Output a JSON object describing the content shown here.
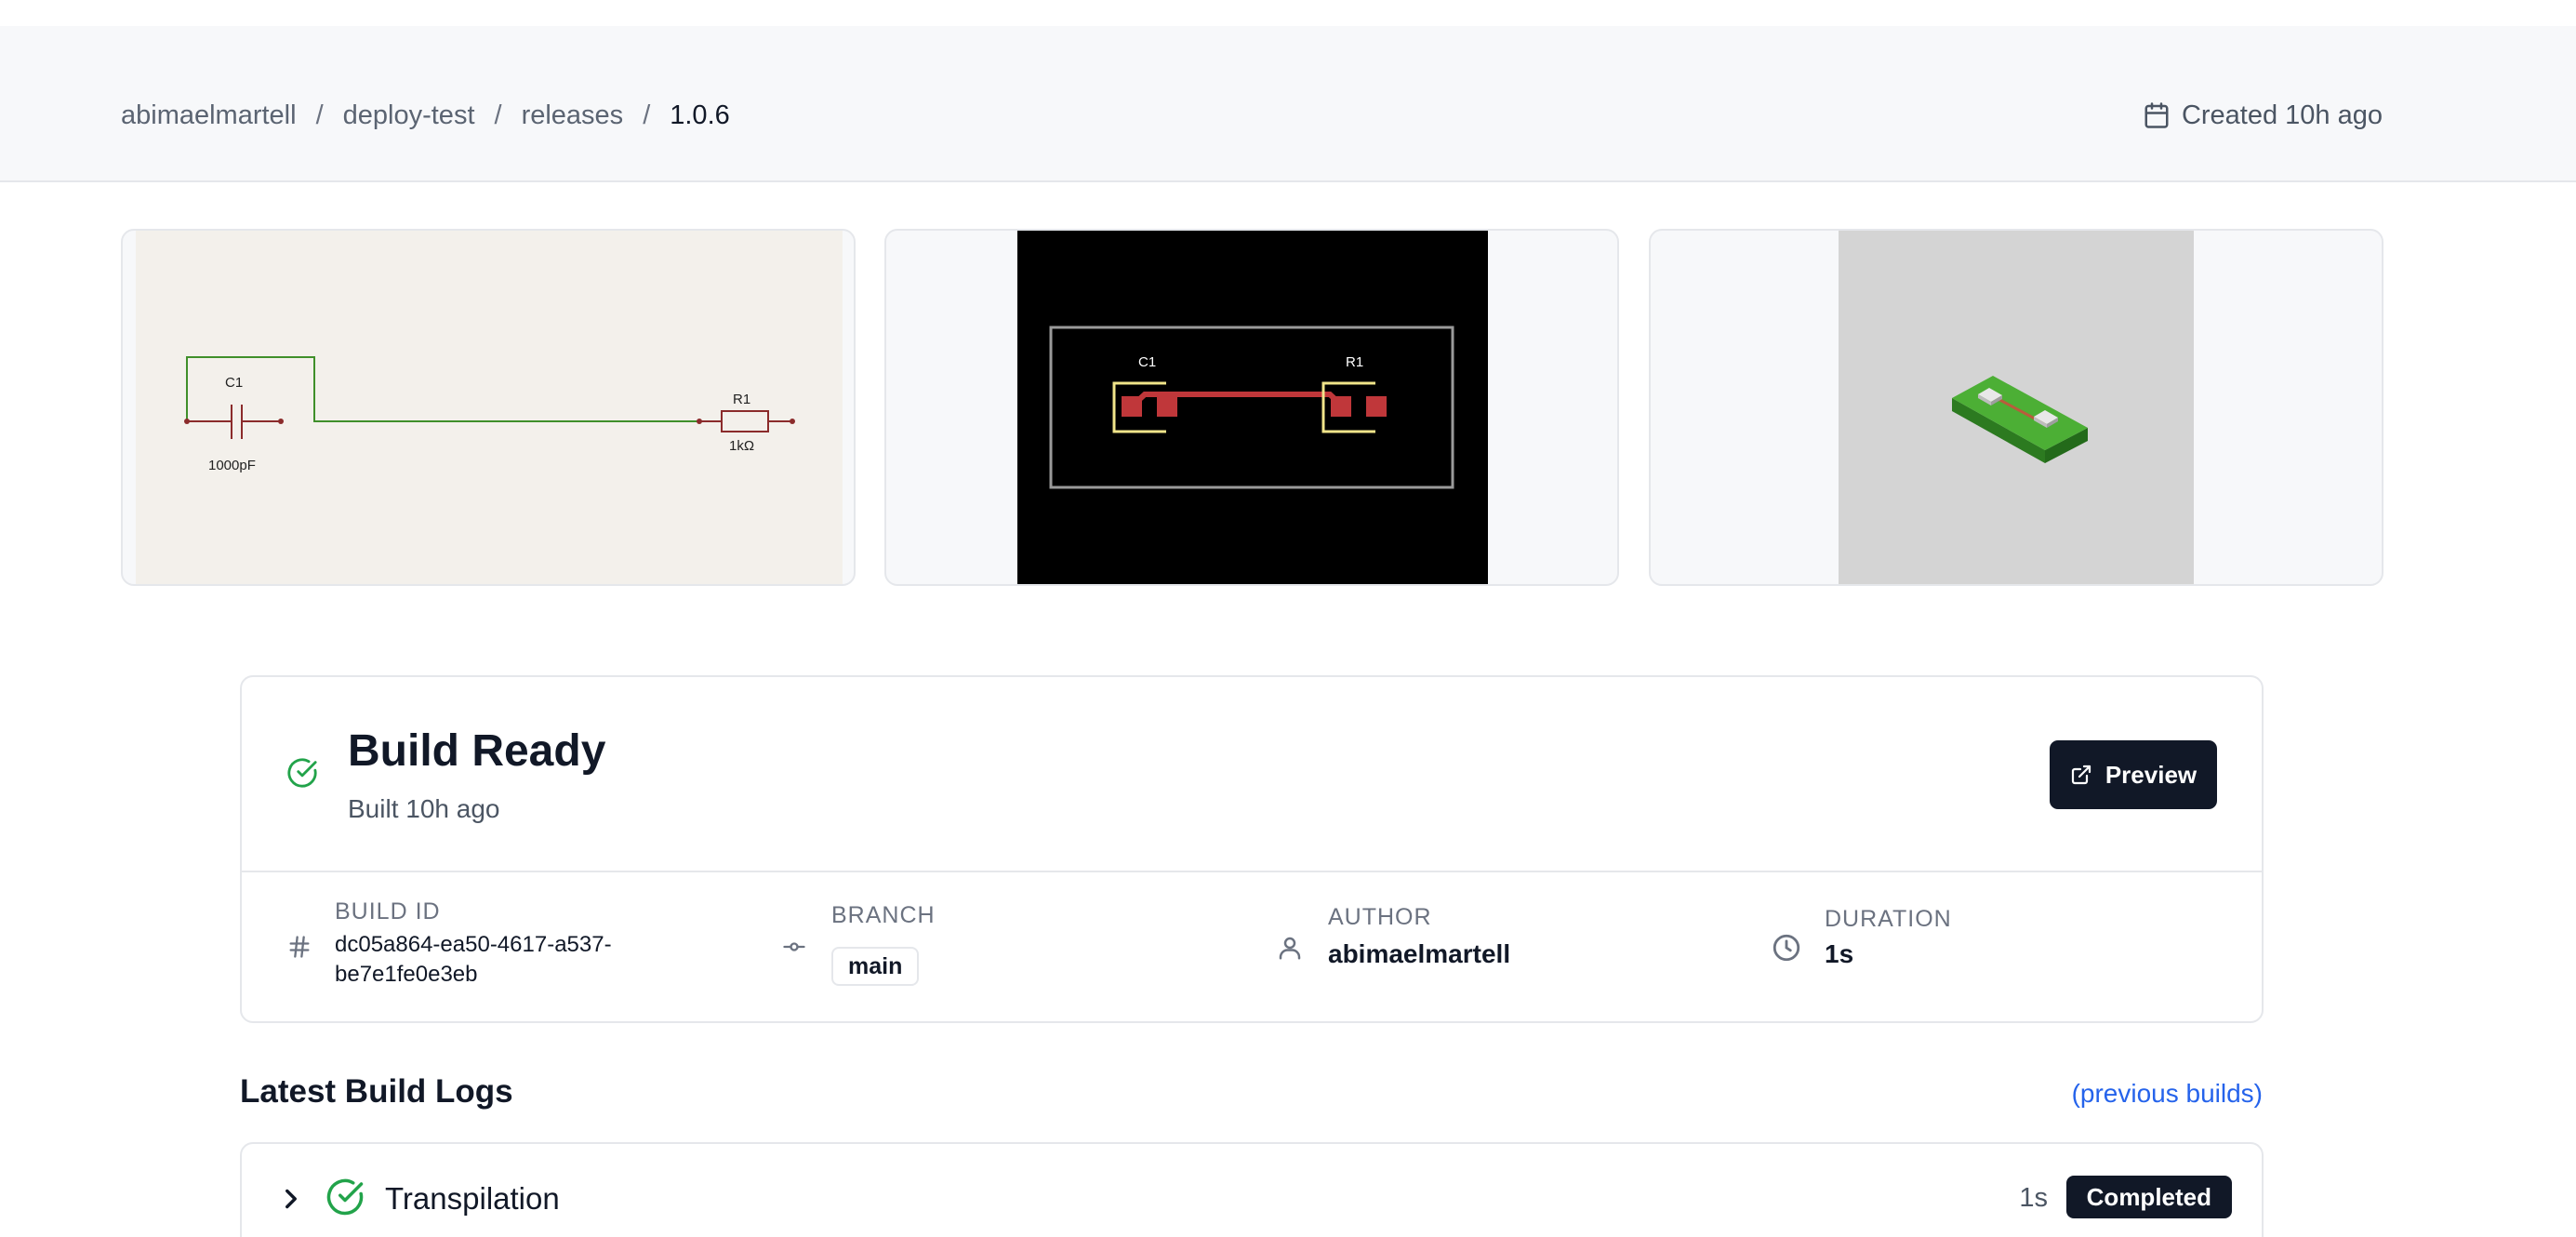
{
  "breadcrumb": {
    "owner": "abimaelmartell",
    "repo": "deploy-test",
    "section": "releases",
    "version": "1.0.6",
    "separator": "/"
  },
  "created": {
    "text": "Created 10h ago",
    "icon": "calendar-icon"
  },
  "previews": {
    "schematic": {
      "c1_ref": "C1",
      "c1_value": "1000pF",
      "r1_ref": "R1",
      "r1_value": "1kΩ"
    },
    "pcb": {
      "c1_ref": "C1",
      "r1_ref": "R1"
    },
    "model_3d": {}
  },
  "build": {
    "status_title": "Build Ready",
    "built_text": "Built 10h ago",
    "status_icon": "check-circle-icon",
    "preview_button": "Preview",
    "meta": {
      "build_id_label": "BUILD ID",
      "build_id_value": "dc05a864-ea50-4617-a537-be7e1fe0e3eb",
      "branch_label": "BRANCH",
      "branch_value": "main",
      "author_label": "AUTHOR",
      "author_value": "abimaelmartell",
      "duration_label": "DURATION",
      "duration_value": "1s"
    }
  },
  "logs": {
    "title": "Latest Build Logs",
    "previous_link": "(previous builds)",
    "steps": [
      {
        "name": "Transpilation",
        "duration": "1s",
        "status": "Completed"
      }
    ]
  },
  "colors": {
    "success_green": "#22a34a",
    "dark": "#111827",
    "link_blue": "#2563eb",
    "pcb_copper": "#c0373a",
    "board_green": "#3f9e2c"
  }
}
